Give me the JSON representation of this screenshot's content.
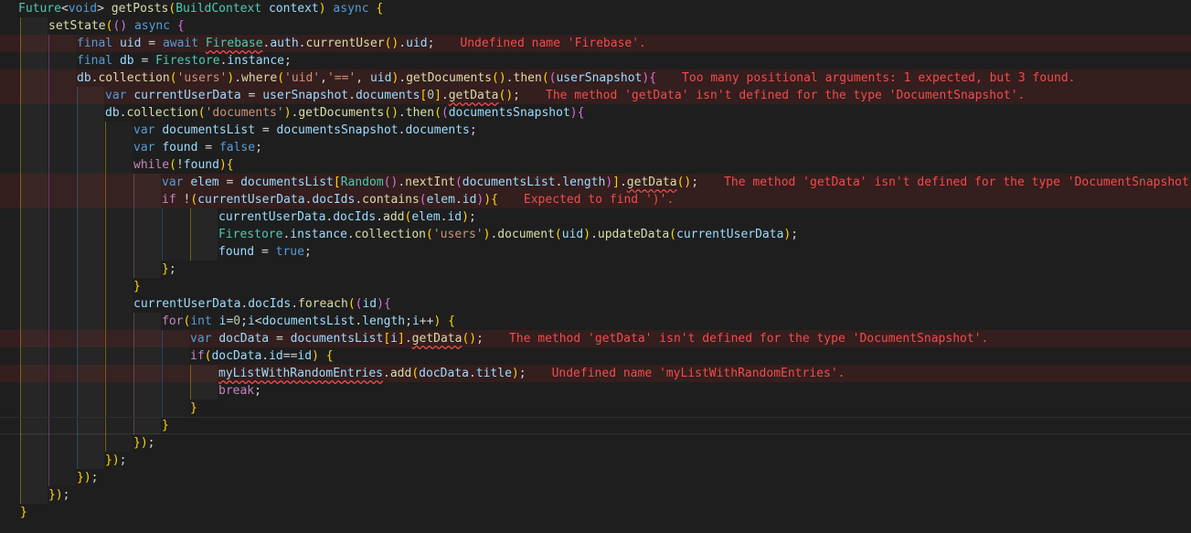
{
  "editor": {
    "language": "Dart",
    "theme_colors": {
      "background": "#1e1e1e",
      "error_text": "#f14c4c",
      "keyword": "#569cd6",
      "type": "#4ec9b0",
      "string": "#ce9178"
    },
    "lines": [
      {
        "code": "Future<void> getPosts(BuildContext context) async {",
        "error": ""
      },
      {
        "code": "setState(() async {",
        "error": ""
      },
      {
        "code": "final uid = await Firebase.auth.currentUser().uid;",
        "error": "Undefined name 'Firebase'."
      },
      {
        "code": "final db = Firestore.instance;",
        "error": ""
      },
      {
        "code": "db.collection('users').where('uid','==', uid).getDocuments().then((userSnapshot){",
        "error": "Too many positional arguments: 1 expected, but 3 found."
      },
      {
        "code": "var currentUserData = userSnapshot.documents[0].getData();",
        "error": "The method 'getData' isn't defined for the type 'DocumentSnapshot'."
      },
      {
        "code": "db.collection('documents').getDocuments().then((documentsSnapshot){",
        "error": ""
      },
      {
        "code": "var documentsList = documentsSnapshot.documents;",
        "error": ""
      },
      {
        "code": "var found = false;",
        "error": ""
      },
      {
        "code": "while(!found){",
        "error": ""
      },
      {
        "code": "var elem = documentsList[Random().nextInt(documentsList.length)].getData();",
        "error": "The method 'getData' isn't defined for the type 'DocumentSnapshot'."
      },
      {
        "code": "if !(currentUserData.docIds.contains(elem.id)){",
        "error": "Expected to find ')'."
      },
      {
        "code": "currentUserData.docIds.add(elem.id);",
        "error": ""
      },
      {
        "code": "Firestore.instance.collection('users').document(uid).updateData(currentUserData);",
        "error": ""
      },
      {
        "code": "found = true;",
        "error": ""
      },
      {
        "code": "};",
        "error": ""
      },
      {
        "code": "}",
        "error": ""
      },
      {
        "code": "currentUserData.docIds.foreach((id){",
        "error": ""
      },
      {
        "code": "for(int i=0;i<documentsList.length;i++) {",
        "error": ""
      },
      {
        "code": "var docData = documentsList[i].getData();",
        "error": "The method 'getData' isn't defined for the type 'DocumentSnapshot'."
      },
      {
        "code": "if(docData.id==id) {",
        "error": ""
      },
      {
        "code": "myListWithRandomEntries.add(docData.title);",
        "error": "Undefined name 'myListWithRandomEntries'."
      },
      {
        "code": "break;",
        "error": ""
      },
      {
        "code": "}",
        "error": ""
      },
      {
        "code": "}",
        "error": ""
      },
      {
        "code": "});",
        "error": ""
      },
      {
        "code": "});",
        "error": ""
      },
      {
        "code": "});",
        "error": ""
      },
      {
        "code": "});",
        "error": ""
      },
      {
        "code": "}",
        "error": ""
      }
    ]
  }
}
